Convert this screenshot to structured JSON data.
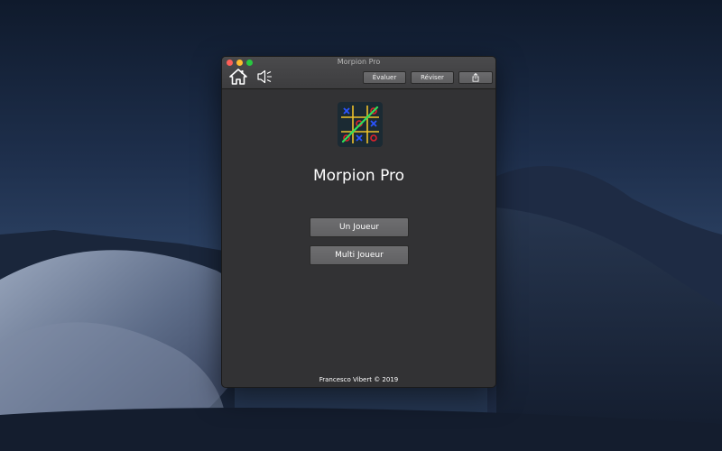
{
  "window": {
    "title": "Morpion Pro"
  },
  "toolbar": {
    "home_icon": "home-icon",
    "sound_icon": "speaker-icon",
    "evaluate_label": "Évaluer",
    "review_label": "Réviser",
    "share_icon": "share-icon"
  },
  "main": {
    "app_title": "Morpion Pro",
    "single_player_label": "Un Joueur",
    "multi_player_label": "Multi Joueur",
    "footer": "Francesco Vibert © 2019"
  },
  "colors": {
    "window_bg": "#323234",
    "button_bg": "#666668",
    "close": "#fe5f57",
    "minimize": "#febc2e",
    "maximize": "#28c840"
  }
}
